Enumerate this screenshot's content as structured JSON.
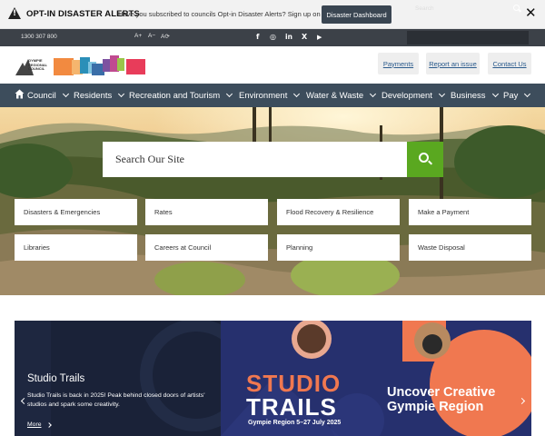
{
  "alert": {
    "title": "OPT-IN DISASTER ALERTS",
    "text": "Have you subscribed to councils Opt-in Disaster Alerts? Sign up on the",
    "button": "Disaster Dashboard",
    "close": "✕"
  },
  "utility": {
    "phone": "1300 307 800",
    "font_larger": "A+",
    "font_smaller": "A−",
    "font_reset": "A⟳",
    "social": [
      "f",
      "◎",
      "in",
      "X",
      "▶"
    ],
    "search_placeholder": "Search"
  },
  "header": {
    "logo_text": "GYMPIE REGIONAL COUNCIL",
    "buttons": [
      "Payments",
      "Report an issue",
      "Contact Us"
    ]
  },
  "nav": {
    "items": [
      "Council",
      "Residents",
      "Recreation and Tourism",
      "Environment",
      "Water & Waste",
      "Development",
      "Business",
      "Pay"
    ]
  },
  "hero": {
    "search_placeholder": "Search Our Site",
    "quick_links": [
      "Disasters & Emergencies",
      "Rates",
      "Flood Recovery & Resilience",
      "Make a Payment",
      "Libraries",
      "Careers at Council",
      "Planning",
      "Waste Disposal"
    ]
  },
  "banner": {
    "title": "Studio Trails",
    "description": "Studio Trails is back in 2025! Peak behind closed doors of artists' studios and spark some creativity.",
    "more": "More",
    "studio_word": "STUDIO",
    "trails_word": "TRAILS",
    "dates": "Gympie Region 5–27 July 2025",
    "headline": "Uncover Creative Gympie Region"
  },
  "colors": {
    "nav_bg": "#3d4d5c",
    "search_green": "#5aa820",
    "banner_dark": "#1a2238",
    "banner_blue": "#26306e",
    "accent_orange": "#f07850"
  }
}
